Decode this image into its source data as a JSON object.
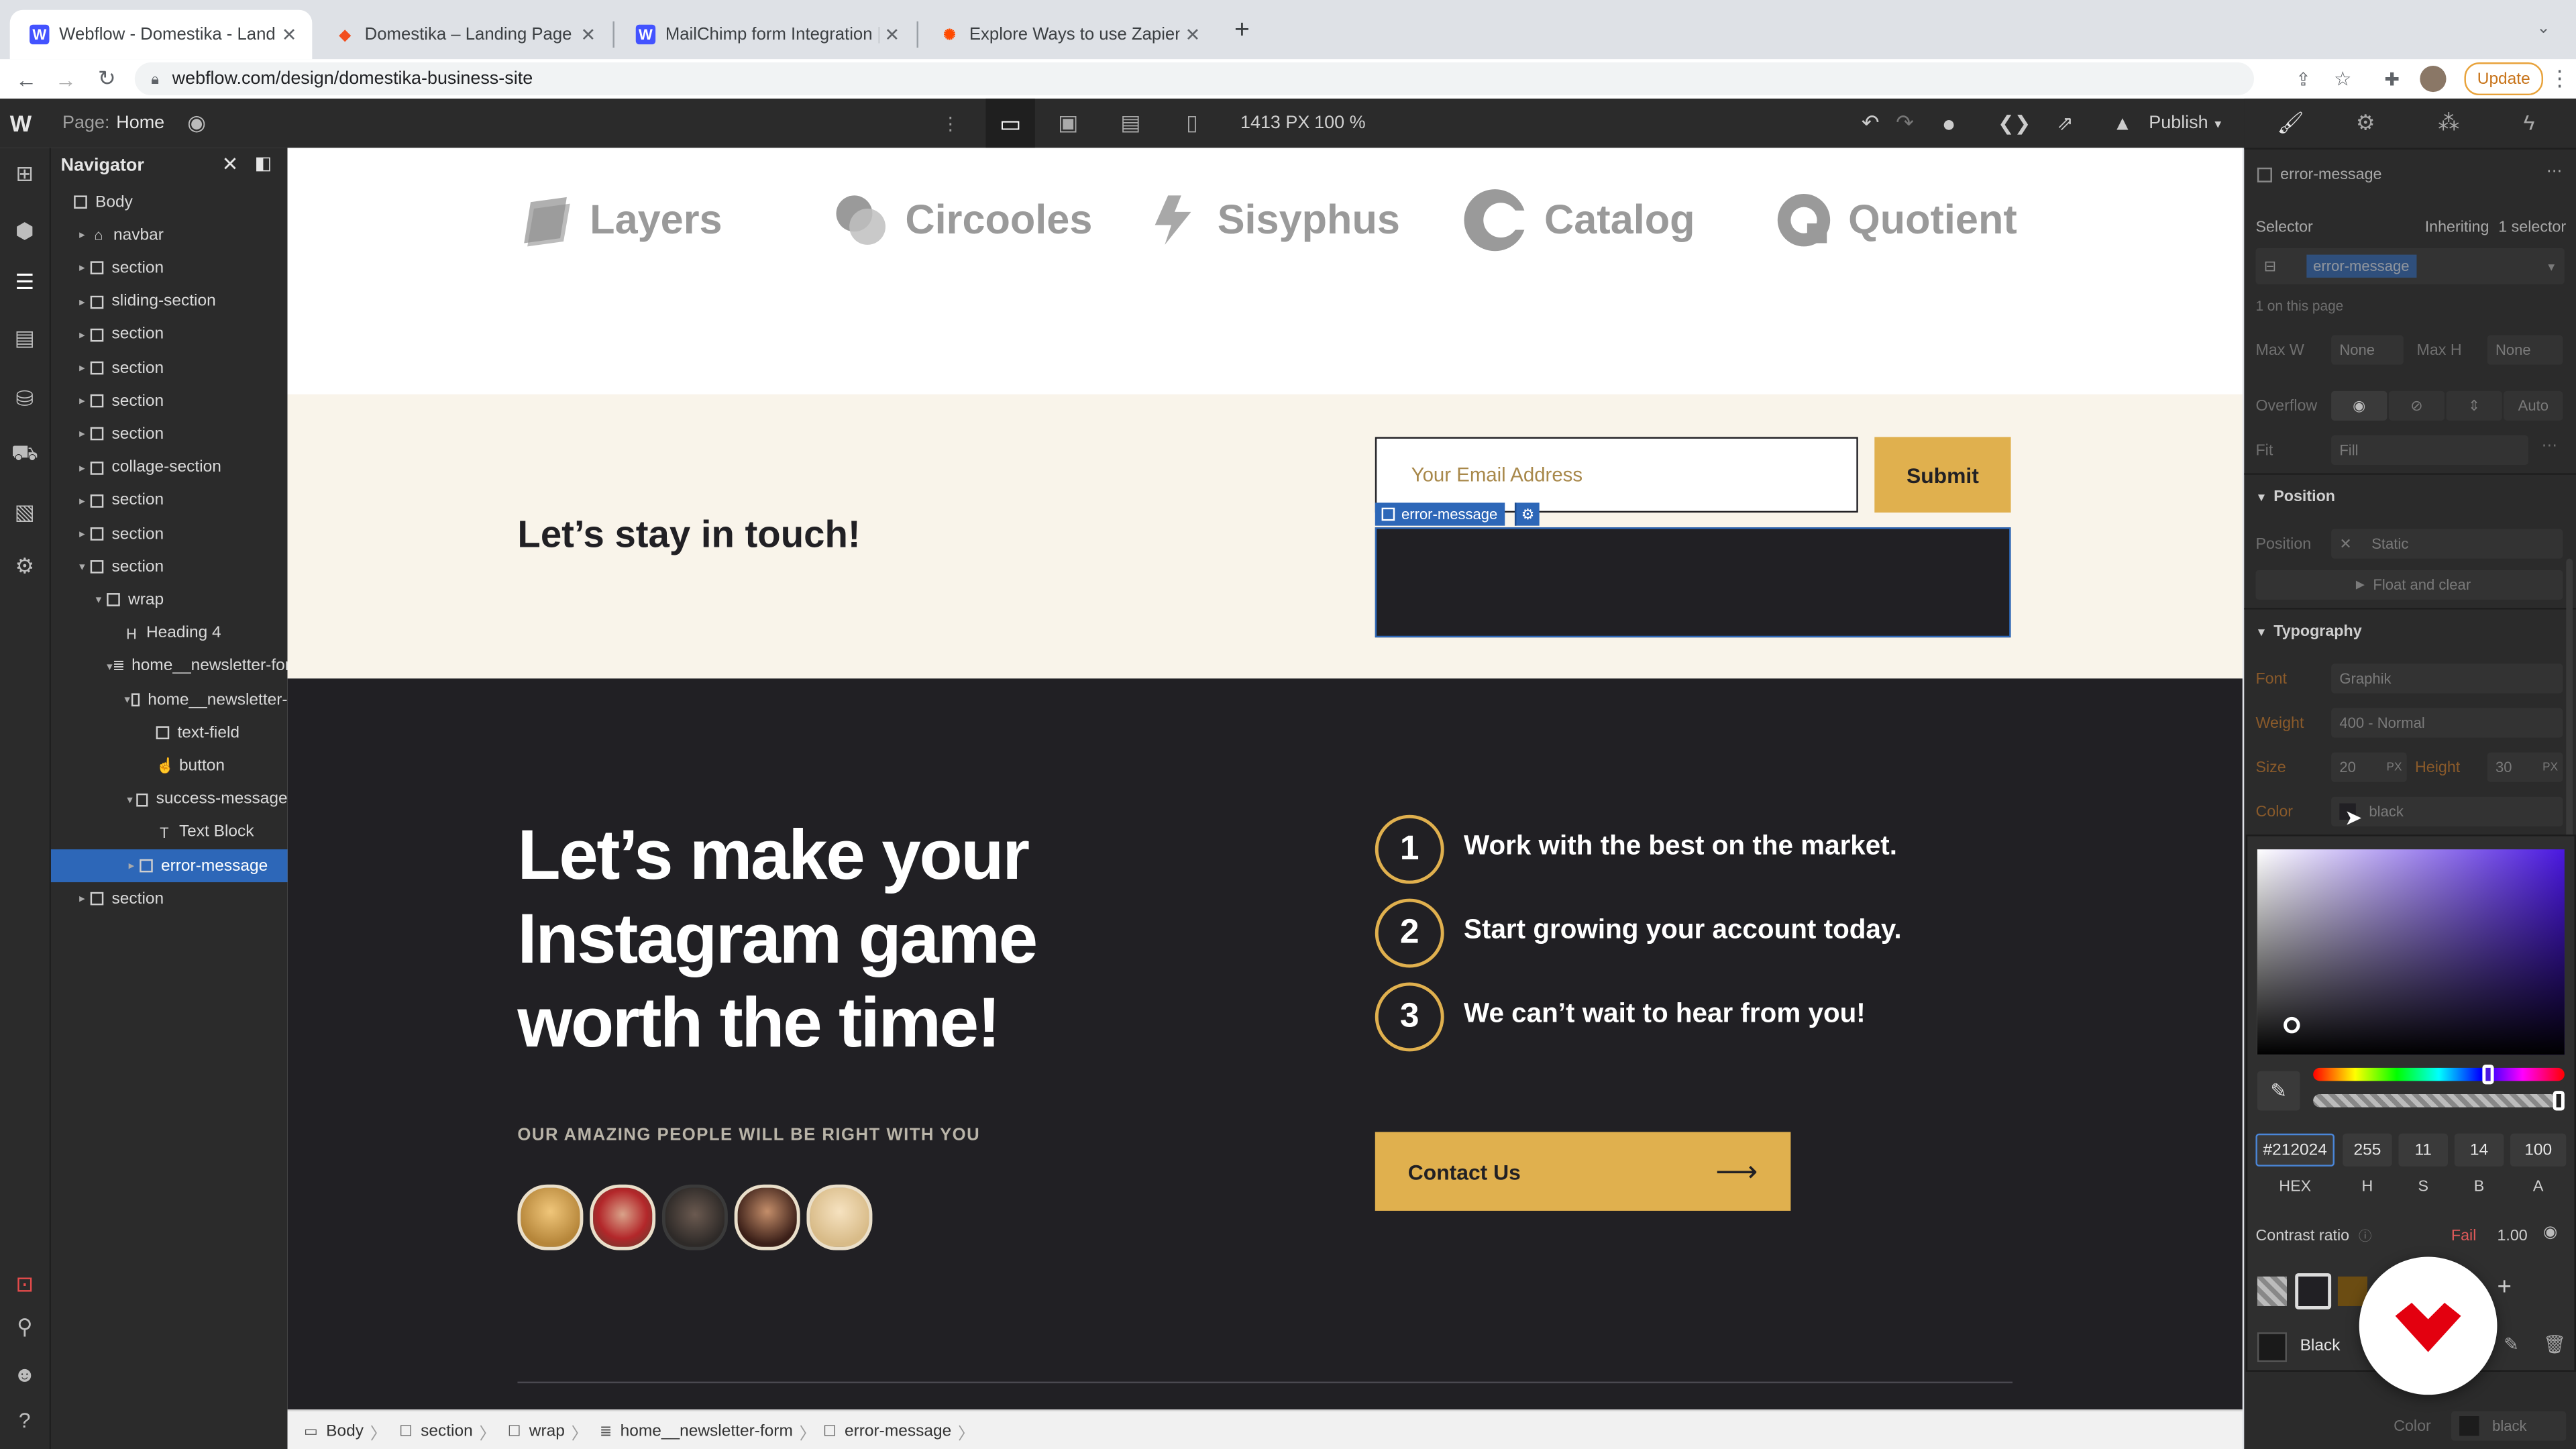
{
  "browser": {
    "tabs": [
      {
        "label": "Webflow - Domestika - Landin",
        "favicon": "webflow-icon",
        "active": true
      },
      {
        "label": "Domestika – Landing Page – Fi",
        "favicon": "figma-icon",
        "active": false
      },
      {
        "label": "MailChimp form Integration | W",
        "favicon": "webflow-icon",
        "active": false
      },
      {
        "label": "Explore Ways to use Zapier by",
        "favicon": "zapier-icon",
        "active": false
      }
    ],
    "new_tab": "+",
    "url": "webflow.com/design/domestika-business-site",
    "update_label": "Update"
  },
  "designer": {
    "page_label": "Page:",
    "page_name": "Home",
    "width_readout": "1413 PX",
    "zoom_readout": "100 %",
    "publish_label": "Publish"
  },
  "navigator": {
    "title": "Navigator",
    "items": [
      {
        "label": "Body",
        "depth": 0,
        "caret": "",
        "icon": "box"
      },
      {
        "label": "navbar",
        "depth": 1,
        "caret": "▸",
        "icon": "home"
      },
      {
        "label": "section",
        "depth": 1,
        "caret": "▸",
        "icon": "box"
      },
      {
        "label": "sliding-section",
        "depth": 1,
        "caret": "▸",
        "icon": "box"
      },
      {
        "label": "section",
        "depth": 1,
        "caret": "▸",
        "icon": "box"
      },
      {
        "label": "section",
        "depth": 1,
        "caret": "▸",
        "icon": "box"
      },
      {
        "label": "section",
        "depth": 1,
        "caret": "▸",
        "icon": "box"
      },
      {
        "label": "section",
        "depth": 1,
        "caret": "▸",
        "icon": "box"
      },
      {
        "label": "collage-section",
        "depth": 1,
        "caret": "▸",
        "icon": "box"
      },
      {
        "label": "section",
        "depth": 1,
        "caret": "▸",
        "icon": "box"
      },
      {
        "label": "section",
        "depth": 1,
        "caret": "▸",
        "icon": "box"
      },
      {
        "label": "section",
        "depth": 1,
        "caret": "▾",
        "icon": "box"
      },
      {
        "label": "wrap",
        "depth": 2,
        "caret": "▾",
        "icon": "box"
      },
      {
        "label": "Heading 4",
        "depth": 3,
        "caret": "",
        "icon": "heading"
      },
      {
        "label": "home__newsletter-for",
        "depth": 3,
        "caret": "▾",
        "icon": "form"
      },
      {
        "label": "home__newsletter-",
        "depth": 4,
        "caret": "▾",
        "icon": "box"
      },
      {
        "label": "text-field",
        "depth": 5,
        "caret": "",
        "icon": "box"
      },
      {
        "label": "button",
        "depth": 5,
        "caret": "",
        "icon": "pointer"
      },
      {
        "label": "success-message",
        "depth": 4,
        "caret": "▾",
        "icon": "box"
      },
      {
        "label": "Text Block",
        "depth": 5,
        "caret": "",
        "icon": "text"
      },
      {
        "label": "error-message",
        "depth": 4,
        "caret": "▸",
        "icon": "box",
        "selected": true
      },
      {
        "label": "section",
        "depth": 1,
        "caret": "▸",
        "icon": "box"
      }
    ]
  },
  "canvas": {
    "logos": [
      "Layers",
      "Circooles",
      "Sisyphus",
      "Catalog",
      "Quotient"
    ],
    "newsletter": {
      "heading": "Let’s stay in touch!",
      "email_placeholder": "Your Email Address",
      "submit_label": "Submit",
      "selected_tag": "error-message"
    },
    "cta": {
      "heading_lines": [
        "Let’s make your",
        "Instagram game",
        "worth the time!"
      ],
      "eyebrow": "OUR AMAZING PEOPLE WILL BE RIGHT WITH YOU",
      "steps": [
        {
          "num": "1",
          "text": "Work with the best on the market."
        },
        {
          "num": "2",
          "text": "Start growing your account today."
        },
        {
          "num": "3",
          "text": "We can’t wait to hear from you!"
        }
      ],
      "contact_label": "Contact Us",
      "contact_arrow": "⟶"
    }
  },
  "breadcrumbs": [
    "Body",
    "section",
    "wrap",
    "home__newsletter-form",
    "error-message"
  ],
  "style_panel": {
    "element_name": "error-message",
    "selector_label": "Selector",
    "inheriting_label": "Inheriting",
    "inheriting_count": "1 selector",
    "selector_chip": "error-message",
    "on_page": "1 on this page",
    "max_w_label": "Max W",
    "max_w_value": "None",
    "max_h_label": "Max H",
    "max_h_value": "None",
    "overflow_label": "Overflow",
    "overflow_auto": "Auto",
    "fit_label": "Fit",
    "fit_value": "Fill",
    "position_section": "Position",
    "position_label": "Position",
    "position_value": "Static",
    "float_label": "Float and clear",
    "typography_section": "Typography",
    "font_label": "Font",
    "font_value": "Graphik",
    "weight_label": "Weight",
    "weight_value": "400 - Normal",
    "size_label": "Size",
    "size_value": "20",
    "size_unit": "PX",
    "height_label": "Height",
    "height_value": "30",
    "height_unit": "PX",
    "color_label": "Color",
    "color_value": "black",
    "bottom_color_label": "Color",
    "bottom_color_value": "black"
  },
  "color_picker": {
    "hex": "#212024",
    "h": "255",
    "s": "11",
    "b": "14",
    "a": "100",
    "hex_label": "HEX",
    "h_label": "H",
    "s_label": "S",
    "b_label": "B",
    "a_label": "A",
    "contrast_label": "Contrast ratio",
    "contrast_status": "Fail",
    "contrast_value": "1.00",
    "swatch_name": "Black",
    "add_label": "+"
  },
  "colors": {
    "accent_gold": "#e0b04e",
    "dark_bg": "#212024",
    "cream_bg": "#f9f4ea",
    "selection_blue": "#2d67b8",
    "domestika_red": "#e3000f"
  }
}
